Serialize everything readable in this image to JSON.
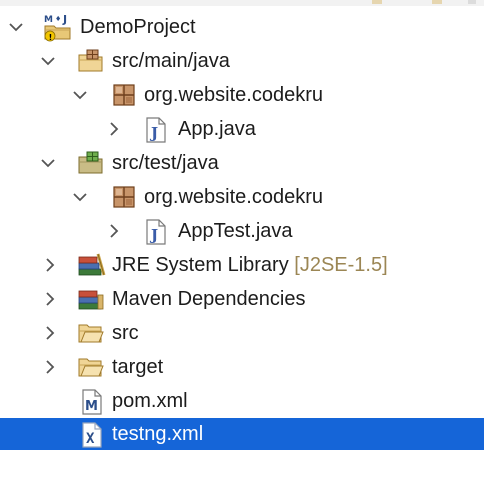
{
  "tree": {
    "project": {
      "label": "DemoProject"
    },
    "src_main_java": {
      "label": "src/main/java"
    },
    "main_package": {
      "label": "org.website.codekru"
    },
    "app_java": {
      "label": "App.java"
    },
    "src_test_java": {
      "label": "src/test/java"
    },
    "test_package": {
      "label": "org.website.codekru"
    },
    "apptest_java": {
      "label": "AppTest.java"
    },
    "jre_library": {
      "label": "JRE System Library",
      "decoration": "[J2SE-1.5]"
    },
    "maven_deps": {
      "label": "Maven Dependencies"
    },
    "src": {
      "label": "src"
    },
    "target": {
      "label": "target"
    },
    "pom": {
      "label": "pom.xml"
    },
    "testng": {
      "label": "testng.xml",
      "selected": true
    }
  },
  "colors": {
    "selection": "#1565d8",
    "decoration": "#9b8654",
    "folder": "#e8c877",
    "package": "#c8956a"
  },
  "icons": {
    "project": "maven-java-project-icon",
    "source_folder": "source-folder-icon",
    "package": "package-icon",
    "java_file": "java-file-icon",
    "library": "library-icon",
    "folder": "folder-icon",
    "pom": "maven-pom-icon",
    "xml": "xml-file-icon",
    "expanded": "chevron-down-icon",
    "collapsed": "chevron-right-icon"
  }
}
